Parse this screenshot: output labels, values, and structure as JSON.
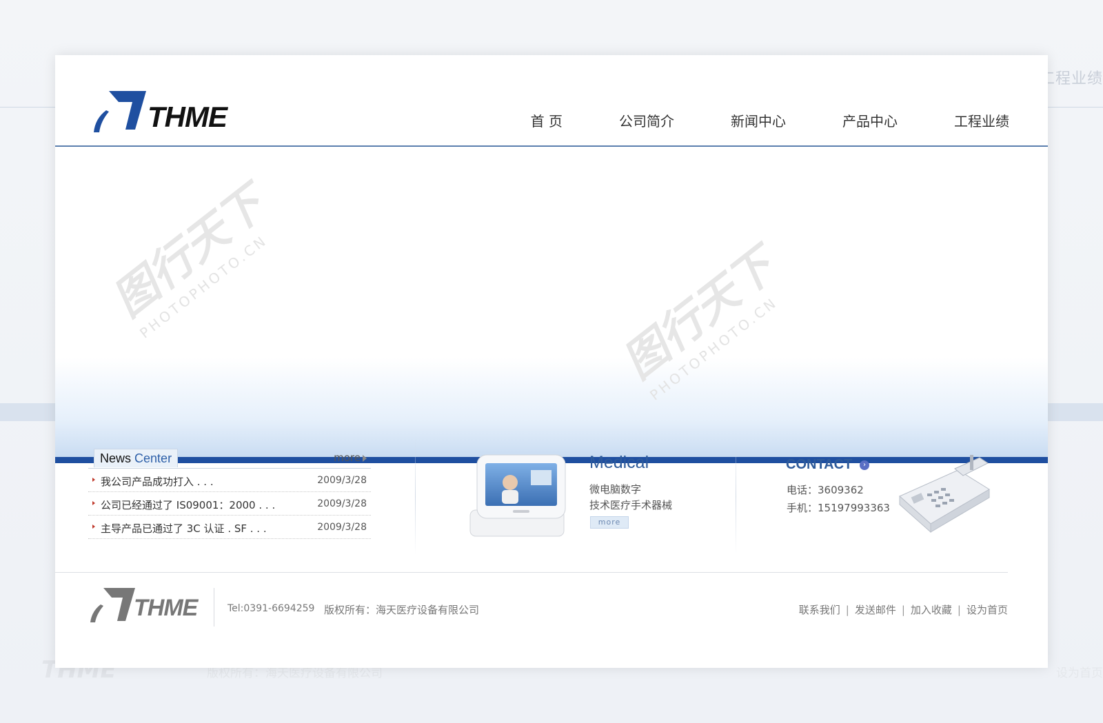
{
  "brand": {
    "logo_text": "THME"
  },
  "nav": {
    "items": [
      {
        "label": "首 页"
      },
      {
        "label": "公司简介"
      },
      {
        "label": "新闻中心"
      },
      {
        "label": "产品中心"
      },
      {
        "label": "工程业绩"
      }
    ]
  },
  "watermark": {
    "cn": "图行天下",
    "en": "PHOTOPHOTO.CN"
  },
  "news": {
    "tab_part1": "News",
    "tab_part2": "Center",
    "more_label": "more",
    "rows": [
      {
        "title": "我公司产品成功打入 . . .",
        "date": "2009/3/28"
      },
      {
        "title": "公司已经通过了 IS09001：2000  . . .",
        "date": "2009/3/28"
      },
      {
        "title": "主导产品已通过了 3C 认证 . SF  . . .",
        "date": "2009/3/28"
      }
    ]
  },
  "medical": {
    "title": "Medical",
    "desc_line1": "微电脑数字",
    "desc_line2": "技术医疗手术器械",
    "more_label": "more"
  },
  "contact": {
    "title": "CONTACT",
    "phone": "电话：3609362",
    "mobile": "手机：15197993363"
  },
  "footer": {
    "logo_text": "THME",
    "tel": "Tel:0391-6694259",
    "copyright": "版权所有：海天医疗设备有限公司",
    "links": [
      {
        "label": "联系我们"
      },
      {
        "label": "发送邮件"
      },
      {
        "label": "加入收藏"
      },
      {
        "label": "设为首页"
      }
    ]
  },
  "colors": {
    "accent_blue": "#1f4fa0",
    "title_blue": "#2d5a9a",
    "bullet_red": "#c0392b"
  }
}
